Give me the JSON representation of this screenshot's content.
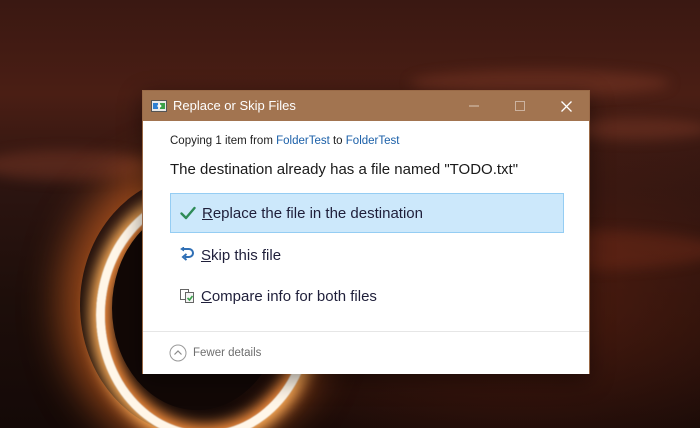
{
  "dialog": {
    "title": "Replace or Skip Files",
    "copy_prefix": "Copying 1 item from ",
    "source_folder": "FolderTest",
    "copy_to": " to ",
    "dest_folder": "FolderTest",
    "message": "The destination already has a file named \"TODO.txt\"",
    "options": [
      {
        "first_char": "R",
        "rest": "eplace the file in the destination",
        "icon": "checkmark-icon",
        "selected": true
      },
      {
        "first_char": "S",
        "rest": "kip this file",
        "icon": "skip-arrow-icon",
        "selected": false
      },
      {
        "first_char": "C",
        "rest": "ompare info for both files",
        "icon": "compare-files-icon",
        "selected": false
      }
    ],
    "footer_label": "Fewer details"
  },
  "colors": {
    "titlebar": "#a27450",
    "selected_bg": "#cce8fb",
    "link": "#1a5fa8",
    "check": "#2e8b57"
  }
}
